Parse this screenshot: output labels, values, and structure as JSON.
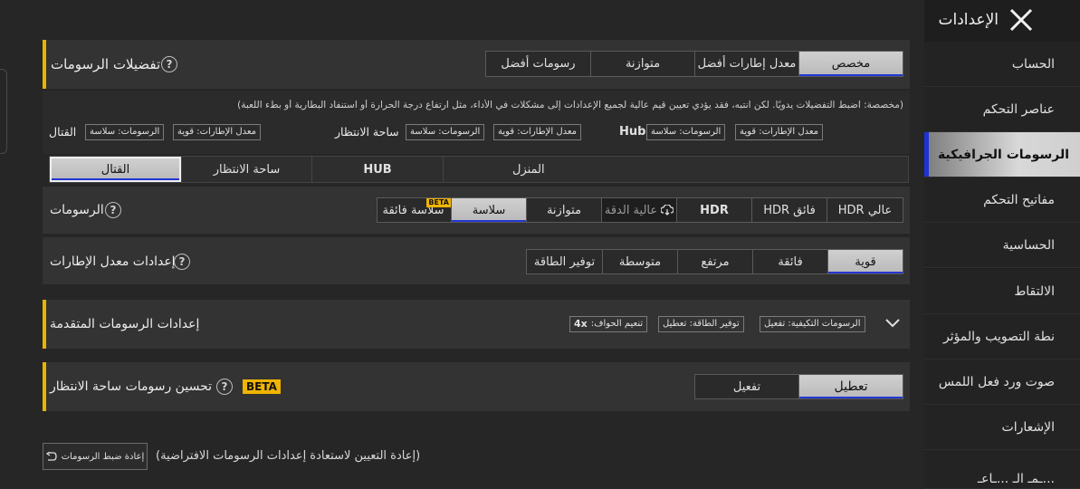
{
  "sidebar": {
    "title": "الإعدادات",
    "items": [
      {
        "label": "الحساب"
      },
      {
        "label": "عناصر التحكم"
      },
      {
        "label": "الرسومات الجرافيكية"
      },
      {
        "label": "مفاتيح التحكم"
      },
      {
        "label": "الحساسية"
      },
      {
        "label": "الالتقاط"
      },
      {
        "label": "نطة التصويب والمؤثر"
      },
      {
        "label": "صوت ورد فعل اللمس"
      },
      {
        "label": "الإشعارات"
      },
      {
        "label": "...ـمـ الـ ...ـاعـ"
      }
    ]
  },
  "graphics_prefs": {
    "title": "تفضيلات الرسومات",
    "options": [
      "مخصص",
      "معدل إطارات أفضل",
      "متوازنة",
      "رسومات أفضل"
    ],
    "selected": "مخصص",
    "note": "(مخصصة: اضبط التفضيلات يدويًا. لكن انتبه، فقد يؤدي تعيين قيم عالية لجميع الإعدادات إلى مشكلات في الأداء، مثل ارتفاع درجة الحرارة أو استنفاد البطارية أو بطء اللعبة)",
    "mode_groups": [
      {
        "name": "Hub",
        "tags": [
          "معدل الإطارات: قوية",
          "الرسومات: سلاسة"
        ]
      },
      {
        "name": "ساحة الانتظار",
        "tags": [
          "معدل الإطارات: قوية",
          "الرسومات: سلاسة"
        ]
      },
      {
        "name": "القتال",
        "tags": [
          "معدل الإطارات: قوية",
          "الرسومات: سلاسة"
        ]
      }
    ]
  },
  "mode_tabs": {
    "items": [
      "المنزل",
      "HUB",
      "ساحة الانتظار",
      "القتال"
    ],
    "selected": "القتال"
  },
  "graphics_quality": {
    "label": "الرسومات",
    "options": [
      "عالي HDR",
      "فائق HDR",
      "HDR",
      "عالية الدقة",
      "متوازنة",
      "سلاسة",
      "سلاسة فائقة"
    ],
    "selected": "سلاسة",
    "beta": "BETA"
  },
  "frame_rate": {
    "label": "إعدادات معدل الإطارات",
    "options": [
      "قوية",
      "فائقة",
      "مرتفع",
      "متوسطة",
      "توفير الطاقة"
    ],
    "selected": "قوية"
  },
  "advanced": {
    "title": "إعدادات الرسومات المتقدمة",
    "tags": [
      "الرسومات التكيفية: تفعيل",
      "توفير الطاقة: تعطيل",
      "تنعيم الحواف:",
      "4x"
    ]
  },
  "lobby_enhance": {
    "title": "تحسين رسومات ساحة الانتظار",
    "beta": "BETA",
    "options": [
      "تعطيل",
      "تفعيل"
    ],
    "selected": "تعطيل"
  },
  "reset": {
    "button": "إعادة ضبط الرسومات",
    "description": "(إعادة التعيين لاستعادة إعدادات الرسومات الافتراضية)"
  }
}
